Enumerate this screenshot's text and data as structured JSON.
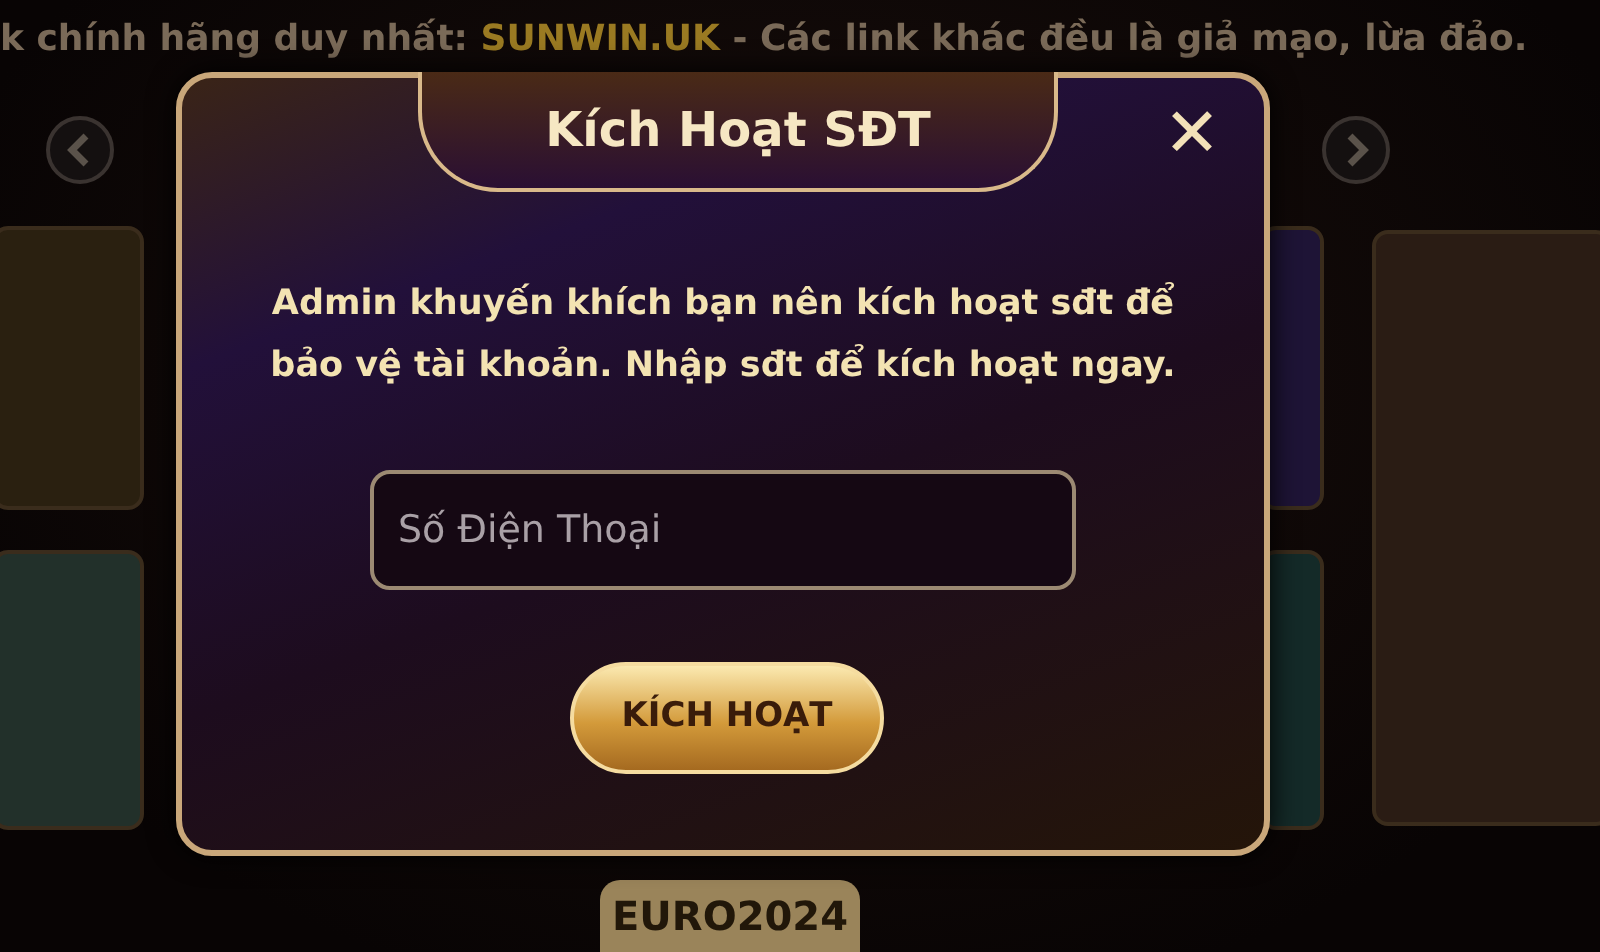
{
  "marquee": {
    "before": "k chính hãng duy nhất:",
    "link": "SUNWIN.UK",
    "after": "- Các link khác đều là giả mạo, lừa đảo."
  },
  "dialog": {
    "title": "Kích Hoạt SĐT",
    "close": "✕",
    "message": "Admin khuyến khích bạn nên kích hoạt sđt để bảo vệ tài khoản. Nhập sđt để kích hoạt ngay.",
    "input": {
      "placeholder": "Số Điện Thoại"
    },
    "button": "KÍCH HOẠT"
  },
  "footer_badge": "EURO2024"
}
